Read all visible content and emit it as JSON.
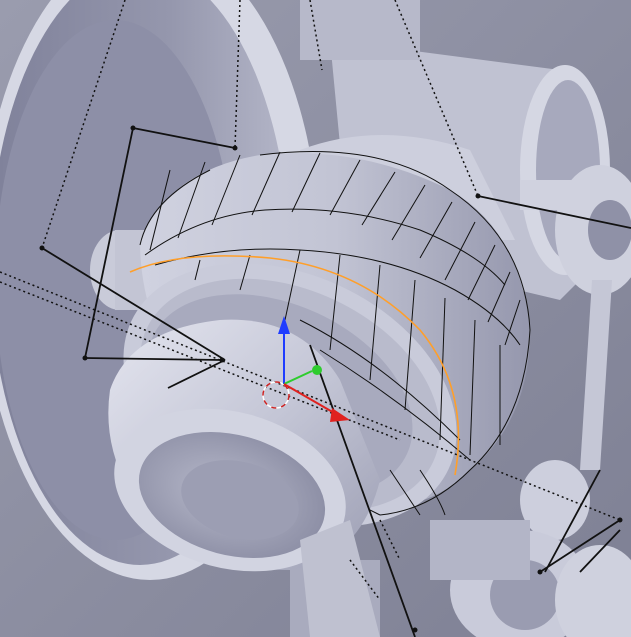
{
  "viewport": {
    "mode": "3d-edit-mode",
    "shading": "solid",
    "selection_color": "#ff9f2a",
    "wire_color": "#111111",
    "background_color": "#8e90a3",
    "gizmo": {
      "x_axis_color": "#e0221f",
      "y_axis_color": "#2ecc2e",
      "z_axis_color": "#1f3cff"
    }
  }
}
